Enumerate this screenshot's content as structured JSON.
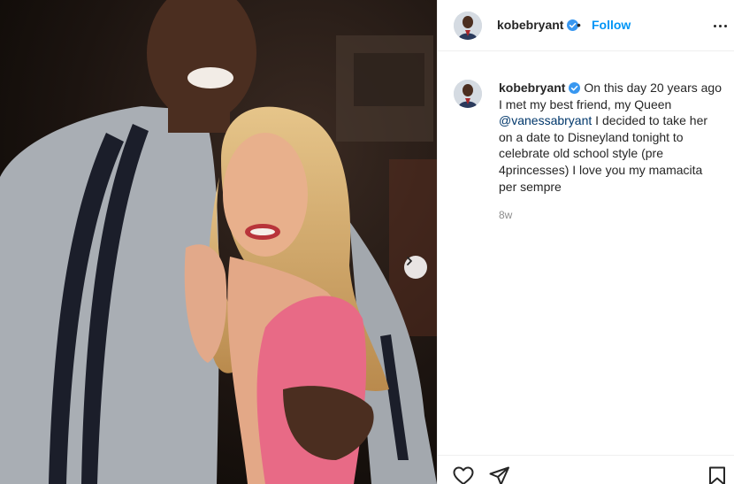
{
  "post": {
    "author": "kobebryant",
    "follow_label": "Follow",
    "separator": "•",
    "caption_line": "On this day 20 years ago I met my best friend, my Queen",
    "mention": "@vanessabryant",
    "caption_rest": "I decided to take her on a date to Disneyland tonight to celebrate old school style (pre 4princesses) I love you my mamacita per sempre",
    "time_ago": "8w"
  },
  "icons": {
    "verified": "verified-badge-icon",
    "more": "more-options-icon",
    "next": "chevron-right-icon",
    "like": "heart-icon",
    "share": "paper-plane-icon",
    "save": "bookmark-icon"
  },
  "colors": {
    "accent": "#0095f6",
    "verified": "#3897f0",
    "mention": "#00376b",
    "muted": "#8e8e8e"
  }
}
